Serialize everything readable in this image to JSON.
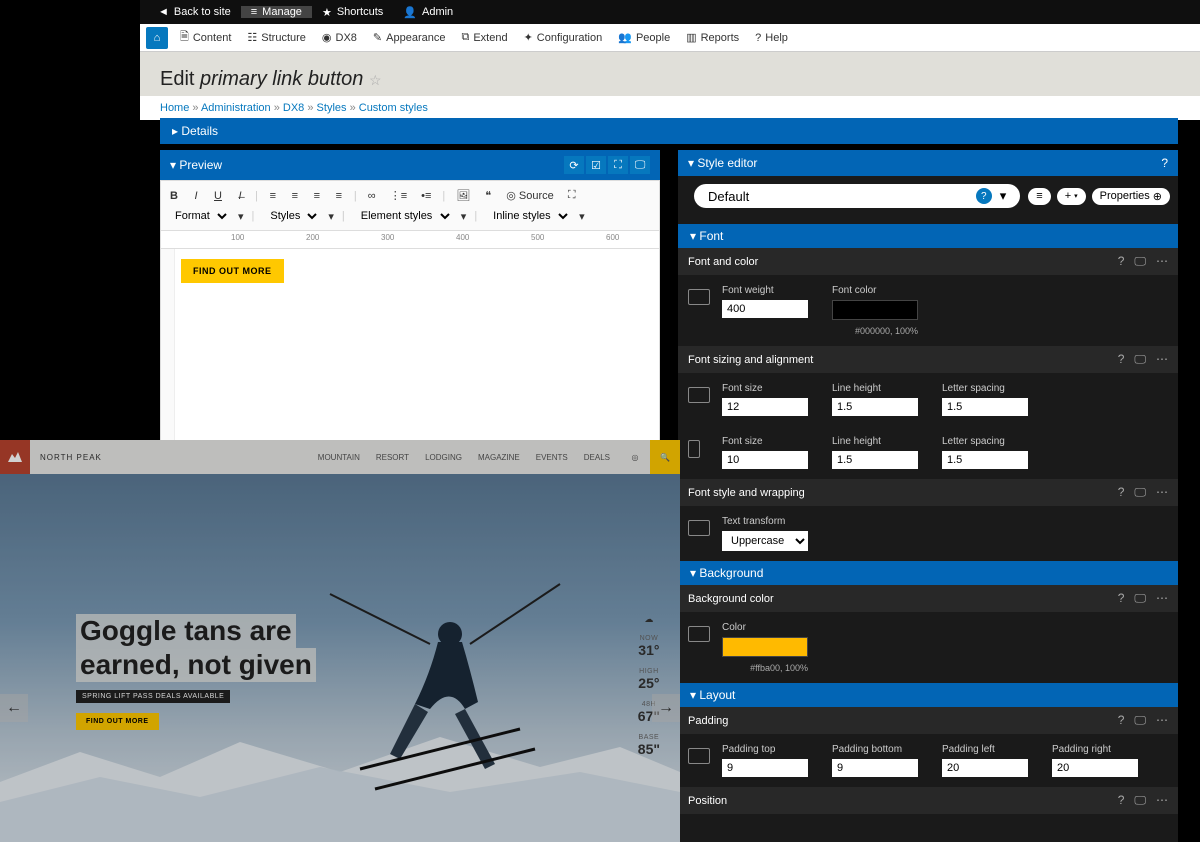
{
  "topbar": {
    "back": "Back to site",
    "manage": "Manage",
    "shortcuts": "Shortcuts",
    "admin": "Admin"
  },
  "adminbar": {
    "items": [
      "Content",
      "Structure",
      "DX8",
      "Appearance",
      "Extend",
      "Configuration",
      "People",
      "Reports",
      "Help"
    ]
  },
  "page_title_prefix": "Edit ",
  "page_title_em": "primary link button",
  "breadcrumb": {
    "parts": [
      "Home",
      "Administration",
      "DX8",
      "Styles",
      "Custom styles"
    ],
    "sep": " » "
  },
  "details_label": "Details",
  "preview": {
    "title": "Preview",
    "format": "Format",
    "styles": "Styles",
    "element_styles": "Element styles",
    "inline_styles": "Inline styles",
    "source": "Source",
    "demo_button": "FIND OUT MORE",
    "ruler_ticks": [
      "100",
      "200",
      "300",
      "400",
      "500",
      "600"
    ]
  },
  "style_editor": {
    "title": "Style editor",
    "default": "Default",
    "properties": "Properties",
    "sections": {
      "font": {
        "title": "Font",
        "font_and_color": {
          "title": "Font and color",
          "font_weight_label": "Font weight",
          "font_weight": "400",
          "font_color_label": "Font color",
          "font_color_caption": "#000000, 100%",
          "font_color": "#000000"
        },
        "sizing": {
          "title": "Font sizing and alignment",
          "row1": {
            "font_size_label": "Font size",
            "font_size": "12",
            "line_height_label": "Line height",
            "line_height": "1.5",
            "letter_spacing_label": "Letter spacing",
            "letter_spacing": "1.5"
          },
          "row2": {
            "font_size_label": "Font size",
            "font_size": "10",
            "line_height_label": "Line height",
            "line_height": "1.5",
            "letter_spacing_label": "Letter spacing",
            "letter_spacing": "1.5"
          }
        },
        "style_wrap": {
          "title": "Font style and wrapping",
          "text_transform_label": "Text transform",
          "text_transform": "Uppercase"
        }
      },
      "background": {
        "title": "Background",
        "bg_color": {
          "title": "Background color",
          "color_label": "Color",
          "color": "#ffba00",
          "caption": "#ffba00, 100%"
        }
      },
      "layout": {
        "title": "Layout",
        "padding": {
          "title": "Padding",
          "top_label": "Padding top",
          "top": "9",
          "bottom_label": "Padding bottom",
          "bottom": "9",
          "left_label": "Padding left",
          "left": "20",
          "right_label": "Padding right",
          "right": "20"
        },
        "position": {
          "title": "Position"
        }
      }
    }
  },
  "site": {
    "name": "NORTH PEAK",
    "nav": [
      "MOUNTAIN",
      "RESORT",
      "LODGING",
      "MAGAZINE",
      "EVENTS",
      "DEALS"
    ],
    "hero_line1": "Goggle tans are",
    "hero_line2": "earned, not given",
    "hero_sub": "SPRING LIFT PASS DEALS AVAILABLE",
    "hero_cta": "FIND OUT MORE",
    "weather": [
      {
        "lbl": "NOW",
        "val": "31°"
      },
      {
        "lbl": "HIGH",
        "val": "25°"
      },
      {
        "lbl": "48H",
        "val": "67\""
      },
      {
        "lbl": "BASE",
        "val": "85\""
      }
    ]
  }
}
